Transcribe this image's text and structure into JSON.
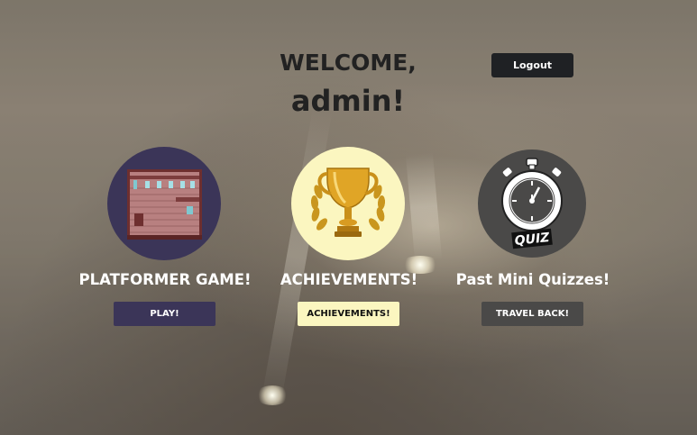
{
  "header": {
    "welcome": "WELCOME,",
    "username": "admin!",
    "logout_label": "Logout"
  },
  "cards": [
    {
      "icon": "brick-room-level-icon",
      "title": "PLATFORMER GAME!",
      "button": "PLAY!",
      "color": "#3b3558"
    },
    {
      "icon": "trophy-laurel-icon",
      "title": "ACHIEVEMENTS!",
      "button": "ACHIEVEMENTS!",
      "color": "#fbf6c0"
    },
    {
      "icon": "stopwatch-quiz-icon",
      "title": "Past Mini Quizzes!",
      "button": "TRAVEL BACK!",
      "color": "#4a4948",
      "badge": "QUIZ"
    }
  ],
  "colors": {
    "logout_bg": "#1f2124",
    "title_text": "#ffffff"
  }
}
